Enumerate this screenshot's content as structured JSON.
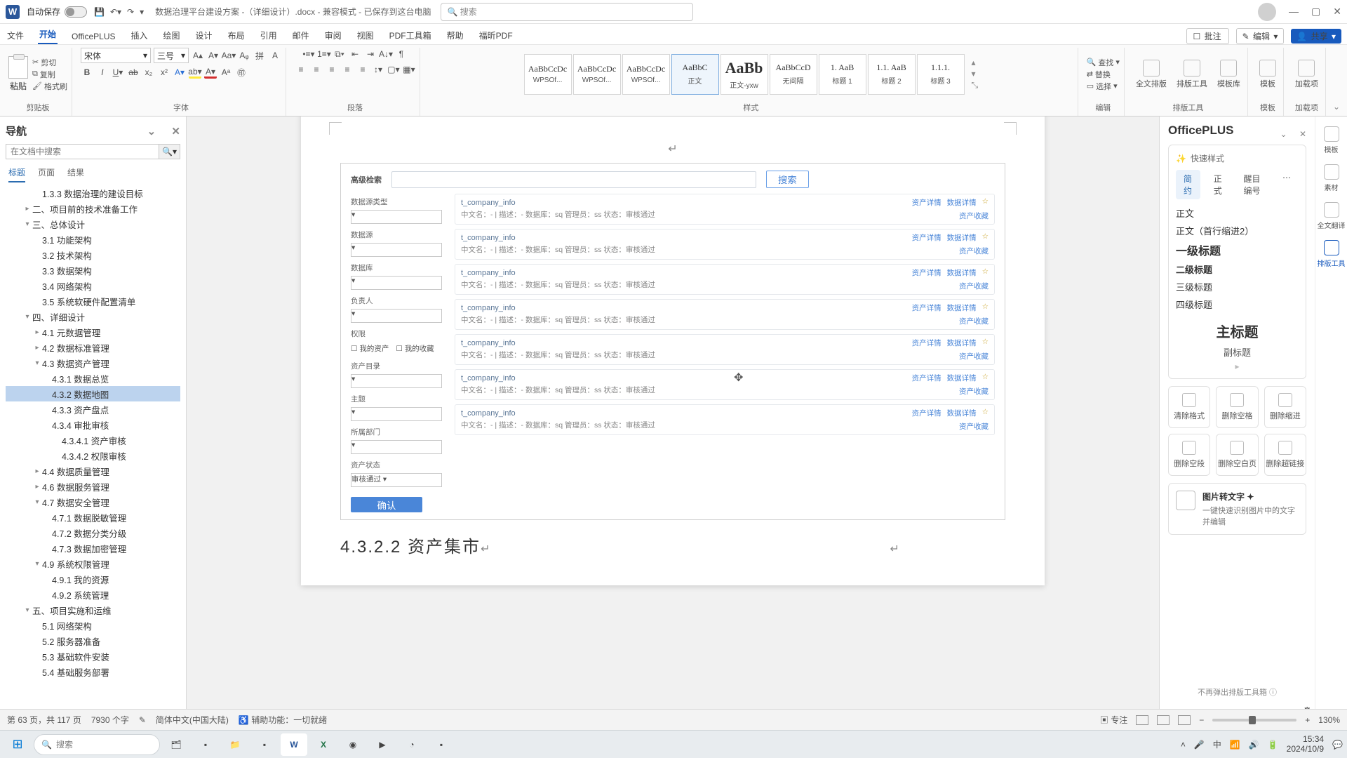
{
  "titlebar": {
    "autosave_label": "自动保存",
    "doc_title": "数据治理平台建设方案 -（详细设计）.docx - 兼容模式 - 已保存到这台电脑",
    "search_placeholder": "搜索"
  },
  "ribtabs": {
    "tabs": [
      "文件",
      "开始",
      "OfficePLUS",
      "插入",
      "绘图",
      "设计",
      "布局",
      "引用",
      "邮件",
      "审阅",
      "视图",
      "PDF工具箱",
      "帮助",
      "福昕PDF"
    ],
    "active": "开始",
    "annot": "批注",
    "edit": "编辑",
    "share": "共享"
  },
  "ribbon": {
    "clipboard": {
      "paste": "粘贴",
      "cut": "剪切",
      "copy": "复制",
      "fmt": "格式刷",
      "label": "剪贴板"
    },
    "font": {
      "name": "宋体",
      "size": "三号",
      "label": "字体"
    },
    "para": {
      "label": "段落"
    },
    "styles": {
      "label": "样式",
      "cards": [
        {
          "prev": "AaBbCcDc",
          "nm": "WPSOf..."
        },
        {
          "prev": "AaBbCcDc",
          "nm": "WPSOf..."
        },
        {
          "prev": "AaBbCcDc",
          "nm": "WPSOf..."
        },
        {
          "prev": "AaBbC",
          "nm": "正文",
          "sel": true
        },
        {
          "prev": "AaBb",
          "nm": "正文-yxw",
          "big": true
        },
        {
          "prev": "AaBbCcD",
          "nm": "无间隔"
        },
        {
          "prev": "1. AaB",
          "nm": "标题 1"
        },
        {
          "prev": "1.1. AaB",
          "nm": "标题 2"
        },
        {
          "prev": "1.1.1.",
          "nm": "标题 3"
        }
      ]
    },
    "editing": {
      "find": "查找",
      "replace": "替换",
      "select": "选择",
      "label": "编辑"
    },
    "layout_tools": {
      "a": "全文排版",
      "b": "排版工具",
      "c": "模板库",
      "label": "排版工具"
    },
    "tmpl": {
      "label": "模板"
    },
    "addin": {
      "a": "加载项",
      "label": "加载项"
    }
  },
  "nav": {
    "title": "导航",
    "search_placeholder": "在文档中搜索",
    "tabs": [
      "标题",
      "页面",
      "结果"
    ],
    "tree": [
      {
        "lv": 3,
        "t": "1.3.3 数据治理的建设目标"
      },
      {
        "lv": 2,
        "t": "二、项目前的技术准备工作",
        "c": "▸"
      },
      {
        "lv": 2,
        "t": "三、总体设计",
        "c": "▾"
      },
      {
        "lv": 3,
        "t": "3.1 功能架构"
      },
      {
        "lv": 3,
        "t": "3.2 技术架构"
      },
      {
        "lv": 3,
        "t": "3.3 数据架构"
      },
      {
        "lv": 3,
        "t": "3.4 网络架构"
      },
      {
        "lv": 3,
        "t": "3.5 系统软硬件配置清单"
      },
      {
        "lv": 2,
        "t": "四、详细设计",
        "c": "▾"
      },
      {
        "lv": 3,
        "t": "4.1 元数据管理",
        "c": "▸"
      },
      {
        "lv": 3,
        "t": "4.2 数据标准管理",
        "c": "▸"
      },
      {
        "lv": 3,
        "t": "4.3 数据资产管理",
        "c": "▾"
      },
      {
        "lv": 4,
        "t": "4.3.1 数据总览"
      },
      {
        "lv": 4,
        "t": "4.3.2 数据地图",
        "sel": true
      },
      {
        "lv": 4,
        "t": "4.3.3 资产盘点"
      },
      {
        "lv": 4,
        "t": "4.3.4 审批审核"
      },
      {
        "lv": 5,
        "t": "4.3.4.1 资产审核"
      },
      {
        "lv": 5,
        "t": "4.3.4.2 权限审核"
      },
      {
        "lv": 3,
        "t": "4.4 数据质量管理",
        "c": "▸"
      },
      {
        "lv": 3,
        "t": "4.6 数据服务管理",
        "c": "▸"
      },
      {
        "lv": 3,
        "t": "4.7 数据安全管理",
        "c": "▾"
      },
      {
        "lv": 4,
        "t": "4.7.1 数据脱敏管理"
      },
      {
        "lv": 4,
        "t": "4.7.2 数据分类分级"
      },
      {
        "lv": 4,
        "t": "4.7.3 数据加密管理"
      },
      {
        "lv": 3,
        "t": "4.9 系统权限管理",
        "c": "▾"
      },
      {
        "lv": 4,
        "t": "4.9.1 我的资源"
      },
      {
        "lv": 4,
        "t": "4.9.2 系统管理"
      },
      {
        "lv": 2,
        "t": "五、项目实施和运维",
        "c": "▾"
      },
      {
        "lv": 3,
        "t": "5.1 网络架构"
      },
      {
        "lv": 3,
        "t": "5.2 服务器准备"
      },
      {
        "lv": 3,
        "t": "5.3 基础软件安装"
      },
      {
        "lv": 3,
        "t": "5.4 基础服务部署"
      }
    ]
  },
  "doc": {
    "adv_search": "高级检索",
    "search_btn": "搜索",
    "filters": {
      "f1": "数据源类型",
      "f2": "数据源",
      "f3": "数据库",
      "f4": "负责人",
      "perm": "权限",
      "cb1": "我的资产",
      "cb2": "我的收藏",
      "f5": "资产目录",
      "f6": "主题",
      "f7": "所属部门",
      "f8": "资产状态",
      "f8v": "审核通过"
    },
    "row": {
      "title": "t_company_info",
      "meta": "中文名：-   |  描述：-      数据库：sq   管理员：ss   状态：审核通过",
      "a1": "资产详情",
      "a2": "数据详情",
      "sub": "资产收藏"
    },
    "confirm": "确认",
    "heading": "4.3.2.2 资产集市"
  },
  "oplus": {
    "title": "OfficePLUS",
    "quick": "快速样式",
    "tabs": [
      "简约",
      "正式",
      "醒目编号"
    ],
    "styles": {
      "body": "正文",
      "body2": "正文（首行缩进2）",
      "h1": "一级标题",
      "h2": "二级标题",
      "h3": "三级标题",
      "h4": "四级标题",
      "mt": "主标题",
      "st": "副标题"
    },
    "btns": [
      "清除格式",
      "删除空格",
      "删除缩进",
      "删除空段",
      "删除空白页",
      "删除超链接"
    ],
    "img2txt_t": "图片转文字 ✦",
    "img2txt_d": "一键快速识别图片中的文字并编辑",
    "rail": [
      "模板",
      "素材",
      "全文翻译",
      "排版工具"
    ],
    "noagain": "不再弹出排版工具箱 ⓘ"
  },
  "status": {
    "page": "第 63 页，共 117 页",
    "words": "7930 个字",
    "lang": "简体中文(中国大陆)",
    "assist": "辅助功能：一切就绪",
    "focus": "专注",
    "zoom": "130%"
  },
  "taskbar": {
    "search": "搜索",
    "time": "15:34",
    "date": "2024/10/9"
  }
}
